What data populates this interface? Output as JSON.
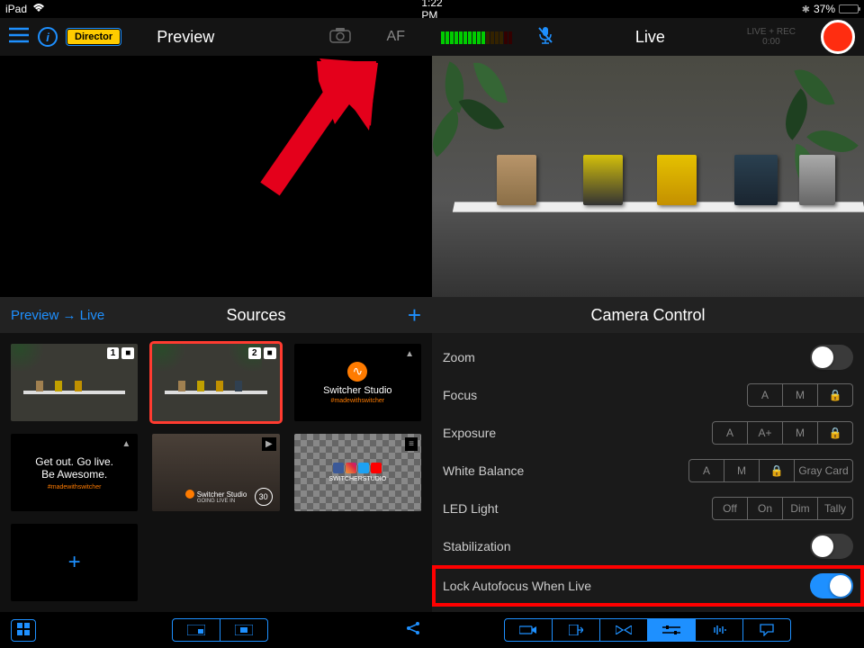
{
  "status": {
    "device": "iPad",
    "time": "1:22 PM",
    "battery_pct": "37%",
    "bluetooth": "✱"
  },
  "preview": {
    "title": "Preview",
    "director_badge": "Director",
    "af_label": "AF"
  },
  "live": {
    "title": "Live",
    "rec_label": "LIVE + REC",
    "rec_time": "0:00"
  },
  "mid": {
    "preview_live": "Preview → Live",
    "sources_title": "Sources",
    "camera_control_title": "Camera Control"
  },
  "sources": {
    "tile1_num": "1",
    "tile2_num": "2",
    "tile3_title": "Switcher Studio",
    "tile3_tag": "#madewithswitcher",
    "tile4_line1": "Get out. Go live.",
    "tile4_line2": "Be Awesome.",
    "tile4_tag": "#madewithswitcher",
    "tile5_brand": "Switcher Studio",
    "tile5_sub": "GOING LIVE IN",
    "tile5_count": "30",
    "tile6_brand": "SWITCHERSTUDIO"
  },
  "controls": {
    "zoom": "Zoom",
    "focus": {
      "label": "Focus",
      "opts": [
        "A",
        "M",
        "🔒"
      ]
    },
    "exposure": {
      "label": "Exposure",
      "opts": [
        "A",
        "A+",
        "M",
        "🔒"
      ]
    },
    "wb": {
      "label": "White Balance",
      "opts": [
        "A",
        "M",
        "🔒",
        "Gray Card"
      ]
    },
    "led": {
      "label": "LED Light",
      "opts": [
        "Off",
        "On",
        "Dim",
        "Tally"
      ]
    },
    "stabilization": "Stabilization",
    "lock_af": "Lock Autofocus When Live"
  }
}
